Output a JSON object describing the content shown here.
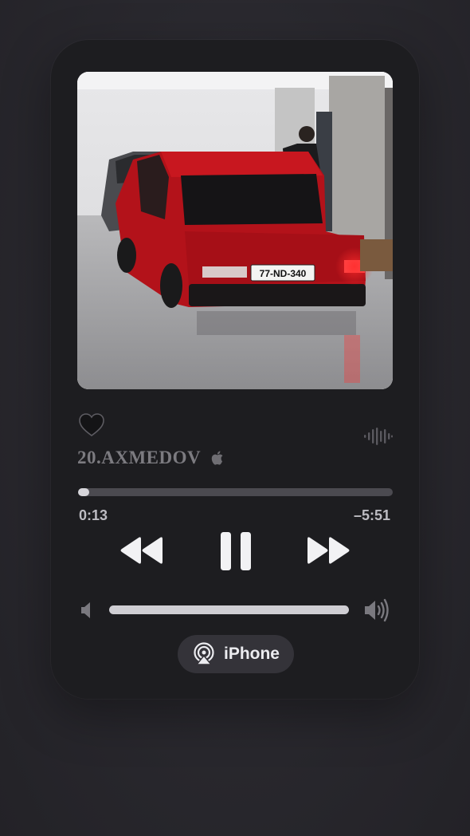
{
  "player": {
    "track_title": "20.AXMEDOV",
    "elapsed": "0:13",
    "remaining": "–5:51",
    "progress_fraction": 0.035,
    "volume_fraction": 1.0,
    "liked": false,
    "output_device": "iPhone",
    "artwork": {
      "plate_text": "77-ND-340"
    }
  },
  "icons": {
    "like": "heart-icon",
    "lyrics_wave": "waveform-icon",
    "explicit_badge": "apple-icon",
    "previous": "rewind-icon",
    "play_pause": "pause-icon",
    "next": "fast-forward-icon",
    "volume_min": "speaker-low-icon",
    "volume_max": "speaker-high-icon",
    "airplay": "airplay-icon"
  },
  "colors": {
    "card": "#1d1d20",
    "accent_fill": "#d6d5da",
    "track": "#4b4a50",
    "title": "#7c7b80"
  }
}
